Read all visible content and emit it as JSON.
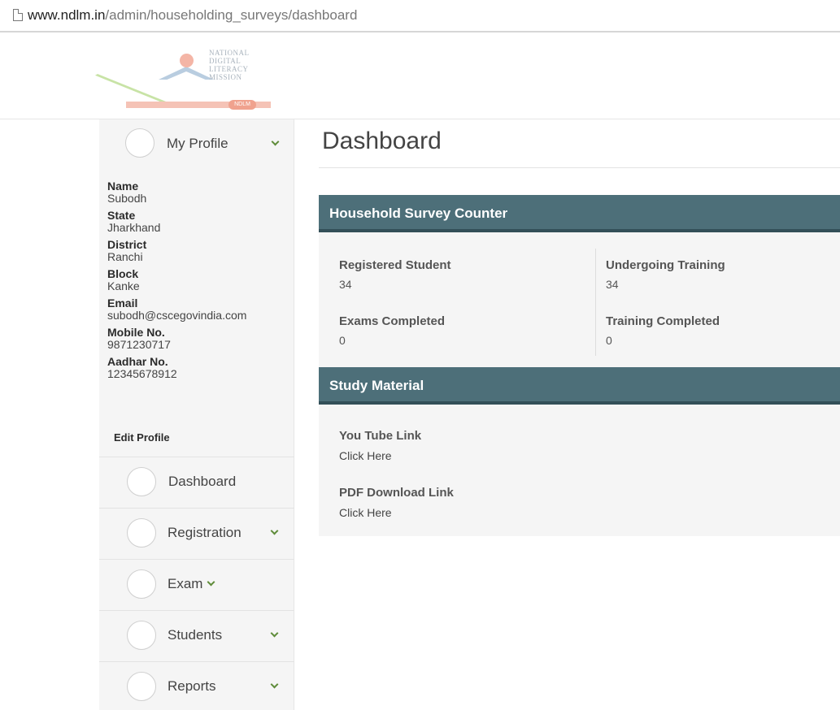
{
  "browser": {
    "url_host": "www.ndlm.in",
    "url_path": "/admin/householding_surveys/dashboard"
  },
  "logo": {
    "lines": [
      "NATIONAL",
      "DIGITAL",
      "LITERACY",
      "MISSION"
    ],
    "badge": "NDLM"
  },
  "sidebar": {
    "profile_label": "My Profile",
    "profile_fields": [
      {
        "label": "Name",
        "value": "Subodh"
      },
      {
        "label": "State",
        "value": "Jharkhand"
      },
      {
        "label": "District",
        "value": "Ranchi"
      },
      {
        "label": "Block",
        "value": "Kanke"
      },
      {
        "label": "Email",
        "value": "subodh@cscegovindia.com"
      },
      {
        "label": "Mobile No.",
        "value": "9871230717"
      },
      {
        "label": "Aadhar No.",
        "value": "12345678912"
      }
    ],
    "edit_profile": "Edit Profile",
    "items": [
      {
        "label": "Dashboard"
      },
      {
        "label": "Registration"
      },
      {
        "label": "Exam"
      },
      {
        "label": "Students"
      },
      {
        "label": "Reports"
      }
    ]
  },
  "main": {
    "title": "Dashboard",
    "counter": {
      "heading": "Household Survey Counter",
      "stats": [
        {
          "label": "Registered Student",
          "value": "34"
        },
        {
          "label": "Undergoing Training",
          "value": "34"
        },
        {
          "label": "Exams Completed",
          "value": "0"
        },
        {
          "label": "Training Completed",
          "value": "0"
        }
      ]
    },
    "study": {
      "heading": "Study Material",
      "links": [
        {
          "label": "You Tube Link",
          "link_text": "Click Here"
        },
        {
          "label": "PDF Download Link",
          "link_text": "Click Here"
        }
      ]
    }
  },
  "colors": {
    "panel_header": "#4d6f79",
    "panel_header_border": "#334f58",
    "chevron": "#5f8c3a",
    "sidebar_bg": "#f5f5f5"
  }
}
